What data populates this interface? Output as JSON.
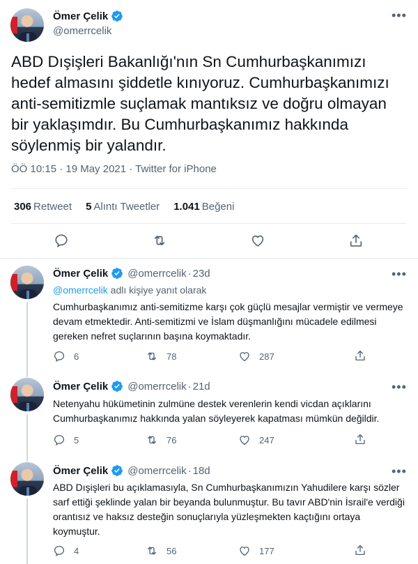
{
  "main": {
    "display_name": "Ömer Çelik",
    "handle": "@omerrcelik",
    "text": "ABD Dışişleri Bakanlığı'nın Sn Cumhurbaşkanımızı hedef almasını şiddetle kınıyoruz. Cumhurbaşkanımızı anti-semitizmle suçlamak mantıksız ve doğru olmayan bir yaklaşımdır. Bu Cumhurbaşkanımız hakkında söylenmiş bir yalandır.",
    "time": "ÖÖ 10:15 · 19 May 2021 · ",
    "source": "Twitter for iPhone",
    "retweets_count": "306",
    "retweets_label": "Retweet",
    "quotes_count": "5",
    "quotes_label": "Alıntı Tweetler",
    "likes_count": "1.041",
    "likes_label": "Beğeni"
  },
  "replies": [
    {
      "display_name": "Ömer Çelik",
      "handle": "@omerrcelik",
      "time": "23d",
      "replying_to_mention": "@omerrcelik",
      "replying_to_suffix": " adlı kişiye yanıt olarak",
      "text": "Cumhurbaşkanımız anti-semitizme karşı çok güçlü mesajlar vermiştir ve vermeye devam etmektedir. Anti-semitizmi ve İslam düşmanlığını mücadele edilmesi gereken nefret suçlarının başına koymaktadır.",
      "reply_count": "6",
      "retweet_count": "78",
      "like_count": "287"
    },
    {
      "display_name": "Ömer Çelik",
      "handle": "@omerrcelik",
      "time": "21d",
      "text": "Netenyahu hükümetinin zulmüne destek verenlerin kendi vicdan açıklarını Cumhurbaşkanımız hakkında yalan söyleyerek kapatması mümkün değildir.",
      "reply_count": "5",
      "retweet_count": "76",
      "like_count": "247"
    },
    {
      "display_name": "Ömer Çelik",
      "handle": "@omerrcelik",
      "time": "18d",
      "text": "ABD Dışişleri bu açıklamasıyla, Sn Cumhurbaşkanımızın Yahudilere karşı sözler sarf ettiği şeklinde yalan bir beyanda bulunmuştur. Bu tavır ABD'nin İsrail'e verdiği orantısız ve haksız desteğin sonuçlarıyla yüzleşmekten kaçtığını ortaya koymuştur.",
      "reply_count": "4",
      "retweet_count": "56",
      "like_count": "177"
    }
  ],
  "colors": {
    "text": "#0f1419",
    "secondary": "#536471",
    "link": "#1d9bf0",
    "divider": "#e6ecf0"
  }
}
